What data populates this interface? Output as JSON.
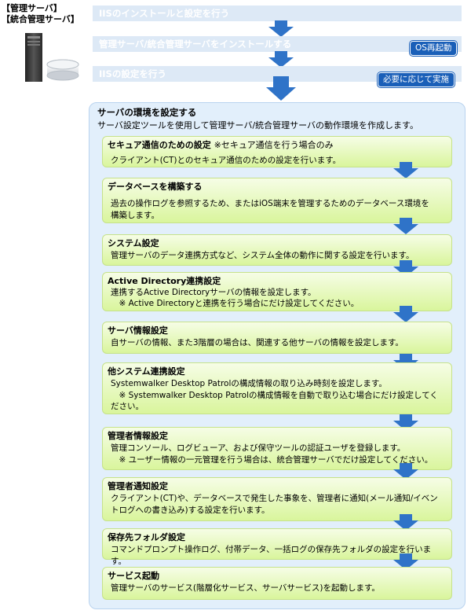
{
  "roles": [
    "【管理サーバ】",
    "【統合管理サーバ】"
  ],
  "top_steps": [
    {
      "label": "IISのインストールと設定を行う",
      "badge": ""
    },
    {
      "label": "管理サーバ/統合管理サーバをインストールする",
      "badge": "OS再起動"
    },
    {
      "label": "IISの設定を行う",
      "badge": "必要に応じて実施"
    }
  ],
  "main": {
    "title": "サーバの環境を設定する",
    "description": "サーバ設定ツールを使用して管理サーバ/統合管理サーバの動作環境を作成します。",
    "substeps": [
      {
        "title": "セキュア通信のための設定",
        "note": "※セキュア通信を行う場合のみ",
        "body": "クライアント(CT)とのセキュア通信のための設定を行います。"
      },
      {
        "title": "データベースを構築する",
        "note": "",
        "body": "過去の操作ログを参照するため、またはiOS端末を管理するためのデータベース環境を\n構築します。"
      },
      {
        "title": "システム設定",
        "note": "",
        "body": "管理サーバのデータ連携方式など、システム全体の動作に関する設定を行います。"
      },
      {
        "title": "Active Directory連携設定",
        "note": "",
        "body": "連携するActive Directoryサーバの情報を設定します。\n　※ Active Directoryと連携を行う場合にだけ設定してください。"
      },
      {
        "title": "サーバ情報設定",
        "note": "",
        "body": "自サーバの情報、また3階層の場合は、関連する他サーバの情報を設定します。"
      },
      {
        "title": "他システム連携設定",
        "note": "",
        "body": "Systemwalker Desktop Patrolの構成情報の取り込み時刻を設定します。\n　※ Systemwalker Desktop Patrolの構成情報を自動で取り込む場合にだけ設定してく\nださい。"
      },
      {
        "title": "管理者情報設定",
        "note": "",
        "body": "管理コンソール、ログビューア、および保守ツールの認証ユーザを登録します。\n　※ ユーザー情報の一元管理を行う場合は、統合管理サーバでだけ設定してください。"
      },
      {
        "title": "管理者通知設定",
        "note": "",
        "body": "クライアント(CT)や、データベースで発生した事象を、管理者に通知(メール通知/イベン\nトログへの書き込み)する設定を行います。"
      },
      {
        "title": "保存先フォルダ設定",
        "note": "",
        "body": "コマンドプロンプト操作ログ、付帯データ、一括ログの保存先フォルダの設定を行います。"
      },
      {
        "title": "サービス起動",
        "note": "",
        "body": "管理サーバのサービス(階層化サービス、サーバサービス)を起動します。"
      }
    ]
  },
  "colors": {
    "accent": "#1a5fb8",
    "arrow_blue": "#2f73c8",
    "panel": "#e2effb",
    "step_green": "#d9f59c"
  }
}
